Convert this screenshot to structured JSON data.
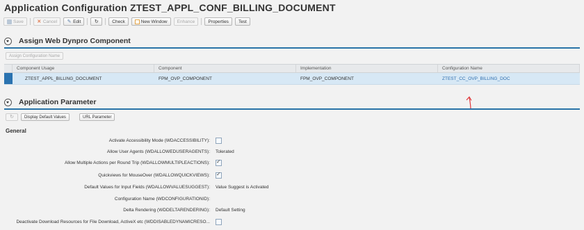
{
  "title": "Application Configuration ZTEST_APPL_CONF_BILLING_DOCUMENT",
  "toolbar": {
    "save": "Save",
    "cancel": "Cancel",
    "edit": "Edit",
    "check": "Check",
    "new_window": "New Window",
    "enhance": "Enhance",
    "properties": "Properties",
    "test": "Test"
  },
  "assign_section": {
    "title": "Assign Web Dynpro Component",
    "assign_button": "Assign Configuration Name",
    "columns": [
      "Component Usage",
      "Component",
      "Implementation",
      "Configuration Name"
    ],
    "rows": [
      {
        "component_usage": "ZTEST_APPL_BILLING_DOCUMENT",
        "component": "FPM_OVP_COMPONENT",
        "implementation": "FPM_OVP_COMPONENT",
        "configuration_name": "ZTEST_CC_OVP_BILLING_DOC"
      }
    ]
  },
  "param_section": {
    "title": "Application Parameter",
    "display_defaults_button": "Display Default Values",
    "url_param_button": "URL Parameter",
    "general_title": "General",
    "params": [
      {
        "label": "Activate Accessibility Mode (WDACCESSIBILITY):",
        "type": "checkbox",
        "checked": false,
        "value": ""
      },
      {
        "label": "Allow User Agents (WDALLOWEDUSERAGENTS):",
        "type": "text",
        "checked": false,
        "value": "Tolerated"
      },
      {
        "label": "Allow Multiple Actions per Round Trip (WDALLOWMULTIPLEACTIONS):",
        "type": "checkbox",
        "checked": true,
        "value": ""
      },
      {
        "label": "Quickviews for MouseOver (WDALLOWQUICKVIEWS):",
        "type": "checkbox",
        "checked": true,
        "value": ""
      },
      {
        "label": "Default Values for Input Fields (WDALLOWVALUESUGGEST):",
        "type": "text",
        "checked": false,
        "value": "Value Suggest is Activated"
      },
      {
        "label": "Configuration Name (WDCONFIGURATIONID):",
        "type": "text",
        "checked": false,
        "value": ""
      },
      {
        "label": "Delta Rendering (WDDELTARENDERING):",
        "type": "text",
        "checked": false,
        "value": "Default Setting"
      },
      {
        "label": "Deactivate Download Resources for File Download, ActiveX etc (WDDISABLEDYNAMICRESO...",
        "type": "checkbox",
        "checked": false,
        "value": ""
      }
    ]
  },
  "colors": {
    "accent": "#2a74a8",
    "selected_row": "#d7e8f5",
    "link": "#2f6fb0",
    "annotation_arrow": "#e0383b"
  }
}
